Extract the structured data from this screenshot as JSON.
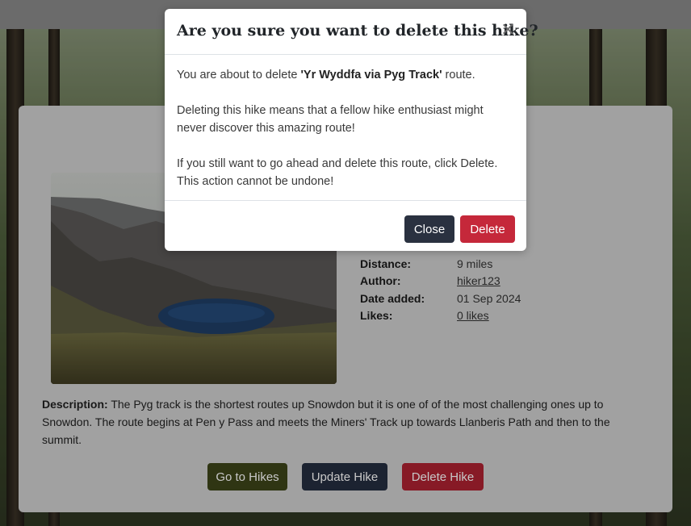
{
  "modal": {
    "title": "Are you sure you want to delete this hike?",
    "close_icon": "×",
    "body_p1_prefix": "You are about to delete ",
    "hike_name": "'Yr Wyddfa via Pyg Track'",
    "body_p1_suffix": " route.",
    "body_p2": "Deleting this hike means that a fellow hike enthusiast might never discover this amazing route!",
    "body_p3": "If you still want to go ahead and delete this route, click Delete. This action cannot be undone!",
    "close_label": "Close",
    "delete_label": "Delete"
  },
  "hike": {
    "details": [
      {
        "label": "Distance:",
        "value": "9 miles",
        "link": false
      },
      {
        "label": "Author:",
        "value": "hiker123",
        "link": true
      },
      {
        "label": "Date added:",
        "value": "01 Sep 2024",
        "link": false
      },
      {
        "label": "Likes:",
        "value": "0 likes",
        "link": true
      }
    ],
    "description_label": "Description:",
    "description": " The Pyg track is the shortest routes up Snowdon but it is one of of the most challenging ones up to Snowdon. The route begins at Pen y Pass and meets the Miners' Track up towards Llanberis Path and then to the summit."
  },
  "buttons": {
    "go_to_hikes": "Go to Hikes",
    "update_hike": "Update Hike",
    "delete_hike": "Delete Hike"
  },
  "colors": {
    "go_to_hikes": "#3d4419",
    "update_hike": "#252d3f",
    "delete_hike": "#ad2231",
    "modal_close": "#2a3140",
    "modal_delete": "#c5283a"
  }
}
